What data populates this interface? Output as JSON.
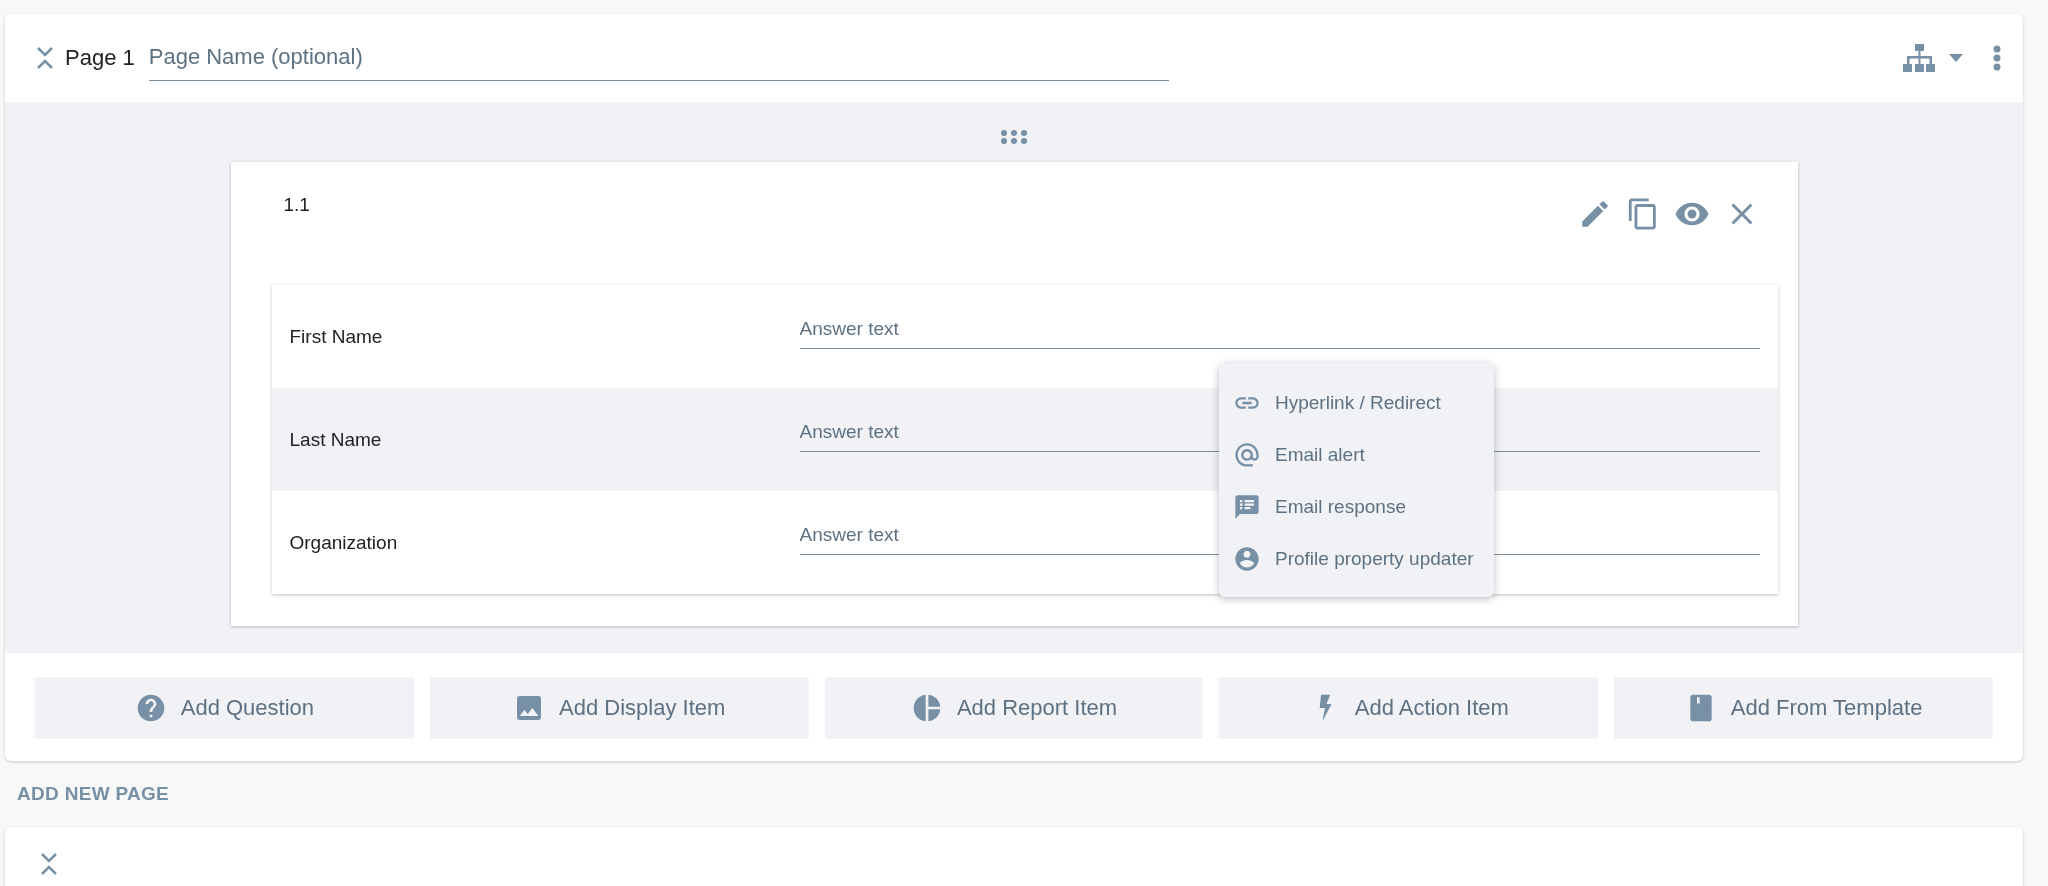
{
  "page": {
    "number_label": "Page 1",
    "name_placeholder": "Page Name (optional)"
  },
  "question": {
    "number": "1.1",
    "rows": [
      {
        "label": "First Name",
        "placeholder": "Answer text"
      },
      {
        "label": "Last Name",
        "placeholder": "Answer text"
      },
      {
        "label": "Organization",
        "placeholder": "Answer text"
      }
    ]
  },
  "action_menu": {
    "items": [
      {
        "kind": "link",
        "label": "Hyperlink / Redirect"
      },
      {
        "kind": "at",
        "label": "Email alert"
      },
      {
        "kind": "notes",
        "label": "Email response"
      },
      {
        "kind": "person",
        "label": "Profile property updater"
      }
    ]
  },
  "add_buttons": [
    {
      "kind": "question",
      "label": "Add Question"
    },
    {
      "kind": "image",
      "label": "Add Display Item"
    },
    {
      "kind": "pie",
      "label": "Add Report Item"
    },
    {
      "kind": "bolt",
      "label": "Add Action Item"
    },
    {
      "kind": "book",
      "label": "Add From Template"
    }
  ],
  "add_new_page": "ADD NEW PAGE"
}
